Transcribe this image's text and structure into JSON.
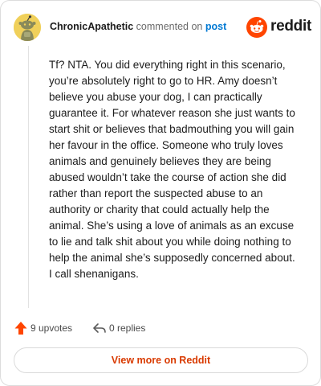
{
  "header": {
    "username": "ChronicApathetic",
    "commented_text": "commented on",
    "post_link": "post",
    "brand_word": "reddit"
  },
  "comment": {
    "text": "Tf? NTA. You did everything right in this scenario, you’re absolutely right to go to HR. Amy doesn’t believe you abuse your dog, I can practically guarantee it. For whatever reason she just wants to start shit or believes that badmouthing you will gain her favour in the office. Someone who truly loves animals and genuinely believes they are being abused wouldn’t take the course of action she did rather than report the suspected abuse to an authority or charity that could actually help the animal. She’s using a love of animals as an excuse to lie and talk shit about you while doing nothing to help the animal she’s supposedly concerned about. I call shenanigans."
  },
  "actions": {
    "upvotes_label": "9 upvotes",
    "replies_label": "0 replies"
  },
  "footer": {
    "view_more_label": "View more on Reddit"
  },
  "icons": {
    "avatar": "snoo-avatar-icon",
    "brand": "reddit-logo-icon",
    "upvote": "upvote-arrow-icon",
    "reply": "reply-arrow-icon"
  },
  "colors": {
    "brand_orange": "#ff4500",
    "upvote": "#ff4500",
    "link_blue": "#0079d3",
    "view_more_text": "#d93a00",
    "avatar_bg": "#f0d05a"
  }
}
